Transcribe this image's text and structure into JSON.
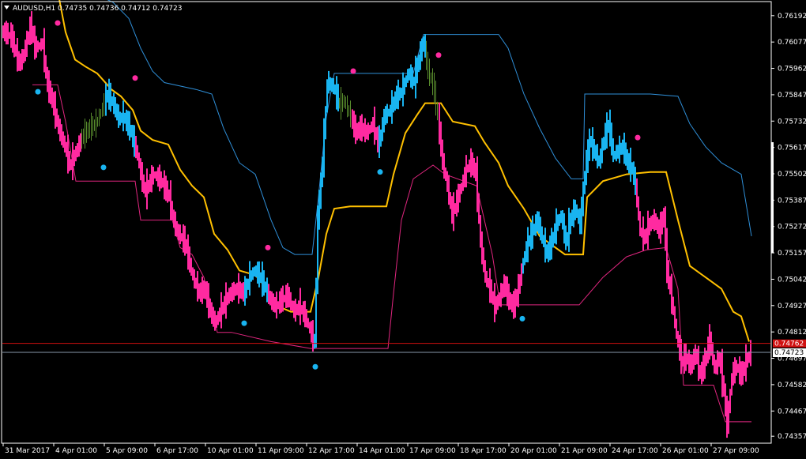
{
  "header": {
    "symbol": "AUDUSD,H1",
    "ohlc": "0.74735 0.74736 0.74712 0.74723"
  },
  "colors": {
    "background": "#000000",
    "axis": "#ffffff",
    "bull": "#19b4f0",
    "bear": "#ff2aa0",
    "neutral": "#5a8f2e",
    "upper_band": "#2f8fd8",
    "lower_band": "#e0267f",
    "middle": "#ffc000",
    "bid_line": "#d01010",
    "last_line": "#8899aa"
  },
  "chart_data": {
    "type": "line",
    "y_axis": {
      "range": [
        0.7433,
        0.7625
      ],
      "ticks": [
        0.76192,
        0.76077,
        0.75962,
        0.75847,
        0.75732,
        0.75617,
        0.75502,
        0.75387,
        0.75272,
        0.75157,
        0.75042,
        0.74927,
        0.74812,
        0.74697,
        0.74582,
        0.74467,
        0.74357
      ],
      "tick_labels": [
        "0.76192",
        "0.76077",
        "0.75962",
        "0.75847",
        "0.75732",
        "0.75617",
        "0.75502",
        "0.75387",
        "0.75272",
        "0.75157",
        "0.75042",
        "0.74927",
        "0.74812",
        "0.74697",
        "0.74582",
        "0.74467",
        "0.74357"
      ]
    },
    "x_axis": {
      "labels": [
        "31 Mar 2017",
        "4 Apr 01:00",
        "5 Apr 09:00",
        "6 Apr 17:00",
        "10 Apr 01:00",
        "11 Apr 09:00",
        "12 Apr 17:00",
        "14 Apr 01:00",
        "17 Apr 09:00",
        "18 Apr 17:00",
        "20 Apr 01:00",
        "21 Apr 09:00",
        "24 Apr 17:00",
        "26 Apr 01:00",
        "27 Apr 09:00"
      ],
      "label_positions": [
        0,
        64,
        128,
        192,
        256,
        320,
        384,
        448,
        512,
        576,
        640,
        704,
        768,
        832,
        896
      ]
    },
    "price_path": [
      [
        0,
        0.7612
      ],
      [
        10,
        0.761
      ],
      [
        20,
        0.7598
      ],
      [
        25,
        0.7601
      ],
      [
        35,
        0.7615
      ],
      [
        40,
        0.7605
      ],
      [
        50,
        0.7607
      ],
      [
        55,
        0.759
      ],
      [
        62,
        0.7582
      ],
      [
        70,
        0.757
      ],
      [
        78,
        0.7562
      ],
      [
        85,
        0.7553
      ],
      [
        90,
        0.7558
      ],
      [
        100,
        0.7566
      ],
      [
        110,
        0.757
      ],
      [
        118,
        0.7572
      ],
      [
        125,
        0.7578
      ],
      [
        132,
        0.7585
      ],
      [
        140,
        0.758
      ],
      [
        146,
        0.7574
      ],
      [
        152,
        0.7575
      ],
      [
        160,
        0.757
      ],
      [
        170,
        0.7558
      ],
      [
        175,
        0.7548
      ],
      [
        180,
        0.7542
      ],
      [
        190,
        0.755
      ],
      [
        200,
        0.7547
      ],
      [
        210,
        0.754
      ],
      [
        215,
        0.753
      ],
      [
        220,
        0.7525
      ],
      [
        230,
        0.752
      ],
      [
        240,
        0.7505
      ],
      [
        248,
        0.7498
      ],
      [
        255,
        0.75
      ],
      [
        262,
        0.749
      ],
      [
        268,
        0.7485
      ],
      [
        275,
        0.749
      ],
      [
        285,
        0.7497
      ],
      [
        295,
        0.75
      ],
      [
        305,
        0.7498
      ],
      [
        312,
        0.7505
      ],
      [
        318,
        0.7508
      ],
      [
        325,
        0.7505
      ],
      [
        332,
        0.75
      ],
      [
        338,
        0.7495
      ],
      [
        345,
        0.7492
      ],
      [
        352,
        0.7495
      ],
      [
        360,
        0.7497
      ],
      [
        368,
        0.749
      ],
      [
        375,
        0.7492
      ],
      [
        382,
        0.7488
      ],
      [
        388,
        0.7482
      ],
      [
        394,
        0.7476
      ],
      [
        398,
        0.753
      ],
      [
        404,
        0.7555
      ],
      [
        410,
        0.759
      ],
      [
        418,
        0.7588
      ],
      [
        426,
        0.758
      ],
      [
        432,
        0.7582
      ],
      [
        440,
        0.7575
      ],
      [
        446,
        0.7568
      ],
      [
        452,
        0.757
      ],
      [
        460,
        0.7568
      ],
      [
        468,
        0.7572
      ],
      [
        475,
        0.7562
      ],
      [
        482,
        0.7575
      ],
      [
        490,
        0.7578
      ],
      [
        498,
        0.7584
      ],
      [
        505,
        0.7586
      ],
      [
        512,
        0.7594
      ],
      [
        520,
        0.759
      ],
      [
        526,
        0.76
      ],
      [
        532,
        0.7608
      ],
      [
        538,
        0.7595
      ],
      [
        545,
        0.7588
      ],
      [
        550,
        0.7575
      ],
      [
        556,
        0.7555
      ],
      [
        562,
        0.7545
      ],
      [
        568,
        0.7532
      ],
      [
        574,
        0.7538
      ],
      [
        580,
        0.7545
      ],
      [
        586,
        0.7552
      ],
      [
        592,
        0.7555
      ],
      [
        598,
        0.755
      ],
      [
        604,
        0.752
      ],
      [
        610,
        0.7505
      ],
      [
        616,
        0.75
      ],
      [
        622,
        0.7492
      ],
      [
        628,
        0.7496
      ],
      [
        634,
        0.7502
      ],
      [
        640,
        0.7495
      ],
      [
        646,
        0.7492
      ],
      [
        652,
        0.75
      ],
      [
        658,
        0.7512
      ],
      [
        664,
        0.752
      ],
      [
        670,
        0.7525
      ],
      [
        676,
        0.753
      ],
      [
        682,
        0.7522
      ],
      [
        688,
        0.7515
      ],
      [
        694,
        0.752
      ],
      [
        700,
        0.7528
      ],
      [
        706,
        0.7532
      ],
      [
        712,
        0.752
      ],
      [
        718,
        0.753
      ],
      [
        724,
        0.7535
      ],
      [
        730,
        0.7528
      ],
      [
        736,
        0.755
      ],
      [
        742,
        0.7565
      ],
      [
        748,
        0.756
      ],
      [
        754,
        0.7555
      ],
      [
        760,
        0.7565
      ],
      [
        766,
        0.7572
      ],
      [
        772,
        0.7558
      ],
      [
        778,
        0.756
      ],
      [
        784,
        0.7562
      ],
      [
        790,
        0.7555
      ],
      [
        796,
        0.7552
      ],
      [
        800,
        0.7545
      ],
      [
        806,
        0.7525
      ],
      [
        812,
        0.7522
      ],
      [
        818,
        0.7528
      ],
      [
        824,
        0.753
      ],
      [
        830,
        0.7525
      ],
      [
        836,
        0.7532
      ],
      [
        840,
        0.7508
      ],
      [
        846,
        0.7495
      ],
      [
        852,
        0.748
      ],
      [
        858,
        0.7468
      ],
      [
        864,
        0.747
      ],
      [
        870,
        0.7466
      ],
      [
        876,
        0.7472
      ],
      [
        882,
        0.7462
      ],
      [
        888,
        0.7468
      ],
      [
        894,
        0.7478
      ],
      [
        900,
        0.7465
      ],
      [
        906,
        0.747
      ],
      [
        912,
        0.7455
      ],
      [
        916,
        0.744
      ],
      [
        922,
        0.7462
      ],
      [
        928,
        0.7466
      ],
      [
        934,
        0.7462
      ],
      [
        940,
        0.7468
      ],
      [
        946,
        0.74723
      ]
    ],
    "color_segments": [
      {
        "from": 0,
        "to": 100,
        "trend": "bear"
      },
      {
        "from": 100,
        "to": 130,
        "trend": "neutral"
      },
      {
        "from": 130,
        "to": 168,
        "trend": "bull"
      },
      {
        "from": 168,
        "to": 306,
        "trend": "bear"
      },
      {
        "from": 306,
        "to": 335,
        "trend": "bull"
      },
      {
        "from": 335,
        "to": 394,
        "trend": "bear"
      },
      {
        "from": 394,
        "to": 426,
        "trend": "bull"
      },
      {
        "from": 426,
        "to": 442,
        "trend": "neutral"
      },
      {
        "from": 442,
        "to": 476,
        "trend": "bear"
      },
      {
        "from": 476,
        "to": 536,
        "trend": "bull"
      },
      {
        "from": 536,
        "to": 552,
        "trend": "neutral"
      },
      {
        "from": 552,
        "to": 658,
        "trend": "bear"
      },
      {
        "from": 658,
        "to": 736,
        "trend": "bull"
      },
      {
        "from": 736,
        "to": 802,
        "trend": "bull"
      },
      {
        "from": 802,
        "to": 946,
        "trend": "bear"
      }
    ],
    "series": [
      {
        "role": "upper_band",
        "points": [
          [
            70,
            0.763
          ],
          [
            80,
            0.763
          ],
          [
            110,
            0.763
          ],
          [
            140,
            0.7625
          ],
          [
            160,
            0.7618
          ],
          [
            175,
            0.7605
          ],
          [
            190,
            0.7595
          ],
          [
            205,
            0.759
          ],
          [
            245,
            0.7587
          ],
          [
            265,
            0.7585
          ],
          [
            280,
            0.757
          ],
          [
            300,
            0.7555
          ],
          [
            320,
            0.755
          ],
          [
            340,
            0.753
          ],
          [
            355,
            0.7518
          ],
          [
            370,
            0.7515
          ],
          [
            392,
            0.7515
          ],
          [
            400,
            0.754
          ],
          [
            410,
            0.7575
          ],
          [
            420,
            0.7594
          ],
          [
            440,
            0.7594
          ],
          [
            480,
            0.7594
          ],
          [
            520,
            0.7594
          ],
          [
            533,
            0.7611
          ],
          [
            600,
            0.7611
          ],
          [
            628,
            0.7611
          ],
          [
            640,
            0.7605
          ],
          [
            660,
            0.7585
          ],
          [
            680,
            0.757
          ],
          [
            700,
            0.7557
          ],
          [
            720,
            0.7548
          ],
          [
            735,
            0.7548
          ],
          [
            737,
            0.7585
          ],
          [
            760,
            0.7585
          ],
          [
            820,
            0.7585
          ],
          [
            855,
            0.7584
          ],
          [
            870,
            0.7572
          ],
          [
            890,
            0.7562
          ],
          [
            910,
            0.7555
          ],
          [
            935,
            0.755
          ],
          [
            948,
            0.7523
          ]
        ]
      },
      {
        "role": "lower_band",
        "points": [
          [
            38,
            0.7589
          ],
          [
            70,
            0.7589
          ],
          [
            80,
            0.7573
          ],
          [
            93,
            0.7547
          ],
          [
            120,
            0.7547
          ],
          [
            168,
            0.7547
          ],
          [
            175,
            0.753
          ],
          [
            215,
            0.753
          ],
          [
            225,
            0.7518
          ],
          [
            240,
            0.7515
          ],
          [
            255,
            0.7505
          ],
          [
            265,
            0.7492
          ],
          [
            272,
            0.7481
          ],
          [
            290,
            0.7481
          ],
          [
            340,
            0.7477
          ],
          [
            390,
            0.7474
          ],
          [
            488,
            0.7474
          ],
          [
            495,
            0.7498
          ],
          [
            505,
            0.753
          ],
          [
            520,
            0.7548
          ],
          [
            545,
            0.7554
          ],
          [
            560,
            0.755
          ],
          [
            600,
            0.7545
          ],
          [
            620,
            0.7515
          ],
          [
            630,
            0.7493
          ],
          [
            650,
            0.7493
          ],
          [
            730,
            0.7493
          ],
          [
            760,
            0.7505
          ],
          [
            790,
            0.7514
          ],
          [
            815,
            0.7517
          ],
          [
            840,
            0.7518
          ],
          [
            855,
            0.75
          ],
          [
            862,
            0.7458
          ],
          [
            900,
            0.7458
          ],
          [
            915,
            0.7442
          ],
          [
            948,
            0.7442
          ]
        ]
      },
      {
        "role": "middle",
        "points": [
          [
            70,
            0.763
          ],
          [
            80,
            0.7612
          ],
          [
            92,
            0.76
          ],
          [
            105,
            0.7597
          ],
          [
            120,
            0.7594
          ],
          [
            138,
            0.7587
          ],
          [
            150,
            0.7584
          ],
          [
            165,
            0.7578
          ],
          [
            175,
            0.7569
          ],
          [
            190,
            0.7565
          ],
          [
            210,
            0.7563
          ],
          [
            225,
            0.7552
          ],
          [
            240,
            0.7545
          ],
          [
            255,
            0.754
          ],
          [
            268,
            0.7524
          ],
          [
            285,
            0.7517
          ],
          [
            300,
            0.7508
          ],
          [
            320,
            0.7506
          ],
          [
            335,
            0.75
          ],
          [
            345,
            0.7493
          ],
          [
            365,
            0.749
          ],
          [
            390,
            0.749
          ],
          [
            400,
            0.7505
          ],
          [
            410,
            0.7524
          ],
          [
            420,
            0.7535
          ],
          [
            440,
            0.7536
          ],
          [
            486,
            0.7536
          ],
          [
            495,
            0.755
          ],
          [
            510,
            0.7568
          ],
          [
            525,
            0.7576
          ],
          [
            535,
            0.7581
          ],
          [
            555,
            0.7581
          ],
          [
            570,
            0.7573
          ],
          [
            598,
            0.7571
          ],
          [
            610,
            0.7564
          ],
          [
            628,
            0.7555
          ],
          [
            640,
            0.7545
          ],
          [
            660,
            0.7535
          ],
          [
            680,
            0.7523
          ],
          [
            700,
            0.7518
          ],
          [
            712,
            0.7515
          ],
          [
            735,
            0.7515
          ],
          [
            740,
            0.754
          ],
          [
            760,
            0.7547
          ],
          [
            790,
            0.755
          ],
          [
            820,
            0.7551
          ],
          [
            840,
            0.7551
          ],
          [
            855,
            0.753
          ],
          [
            870,
            0.751
          ],
          [
            890,
            0.7505
          ],
          [
            910,
            0.75
          ],
          [
            925,
            0.749
          ],
          [
            935,
            0.7488
          ],
          [
            945,
            0.7477
          ]
        ]
      }
    ],
    "signals": [
      {
        "x": 70,
        "y": 0.7616,
        "type": "sell"
      },
      {
        "x": 45,
        "y": 0.7586,
        "type": "buy"
      },
      {
        "x": 168,
        "y": 0.7592,
        "type": "sell"
      },
      {
        "x": 128,
        "y": 0.7553,
        "type": "buy"
      },
      {
        "x": 336,
        "y": 0.7518,
        "type": "sell"
      },
      {
        "x": 306,
        "y": 0.7485,
        "type": "buy"
      },
      {
        "x": 396,
        "y": 0.7466,
        "type": "buy"
      },
      {
        "x": 444,
        "y": 0.7595,
        "type": "sell"
      },
      {
        "x": 478,
        "y": 0.7551,
        "type": "buy"
      },
      {
        "x": 552,
        "y": 0.7602,
        "type": "sell"
      },
      {
        "x": 658,
        "y": 0.7487,
        "type": "buy"
      },
      {
        "x": 804,
        "y": 0.7566,
        "type": "sell"
      }
    ],
    "bid_price": 0.74762,
    "last_price": 0.74723,
    "bid_label": "0.74762",
    "last_label": "0.74723"
  }
}
